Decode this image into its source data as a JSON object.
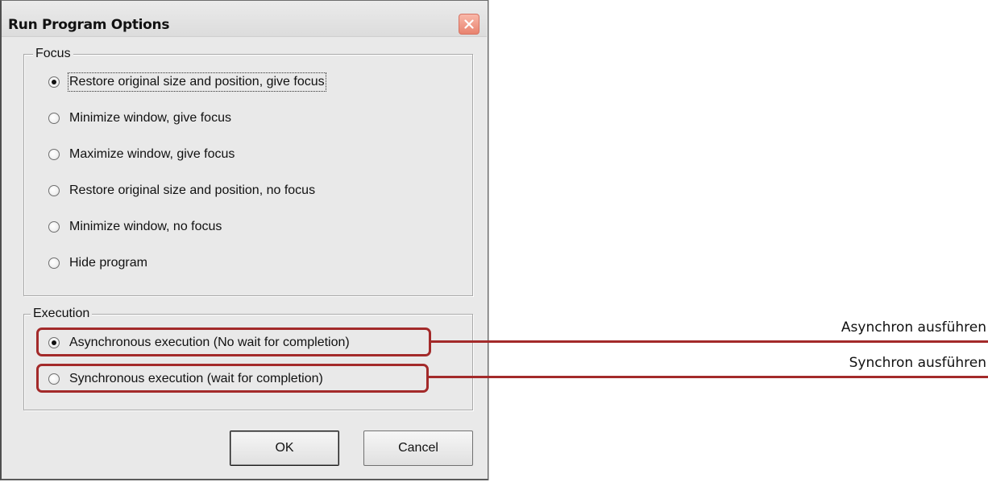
{
  "window": {
    "title": "Run Program Options"
  },
  "focus_group": {
    "label": "Focus",
    "options": [
      {
        "label": "Restore original size and position, give focus",
        "checked": true
      },
      {
        "label": "Minimize window, give focus",
        "checked": false
      },
      {
        "label": "Maximize window, give focus",
        "checked": false
      },
      {
        "label": "Restore original size and position, no focus",
        "checked": false
      },
      {
        "label": "Minimize window, no focus",
        "checked": false
      },
      {
        "label": "Hide program",
        "checked": false
      }
    ]
  },
  "execution_group": {
    "label": "Execution",
    "options": [
      {
        "label": "Asynchronous execution (No wait for completion)",
        "checked": true
      },
      {
        "label": "Synchronous execution (wait for completion)",
        "checked": false
      }
    ]
  },
  "buttons": {
    "ok": "OK",
    "cancel": "Cancel"
  },
  "annotations": {
    "async": "Asynchron ausführen",
    "sync": "Synchron ausführen",
    "highlight_color": "#a32a2a"
  },
  "icons": {
    "close": "close-icon"
  }
}
